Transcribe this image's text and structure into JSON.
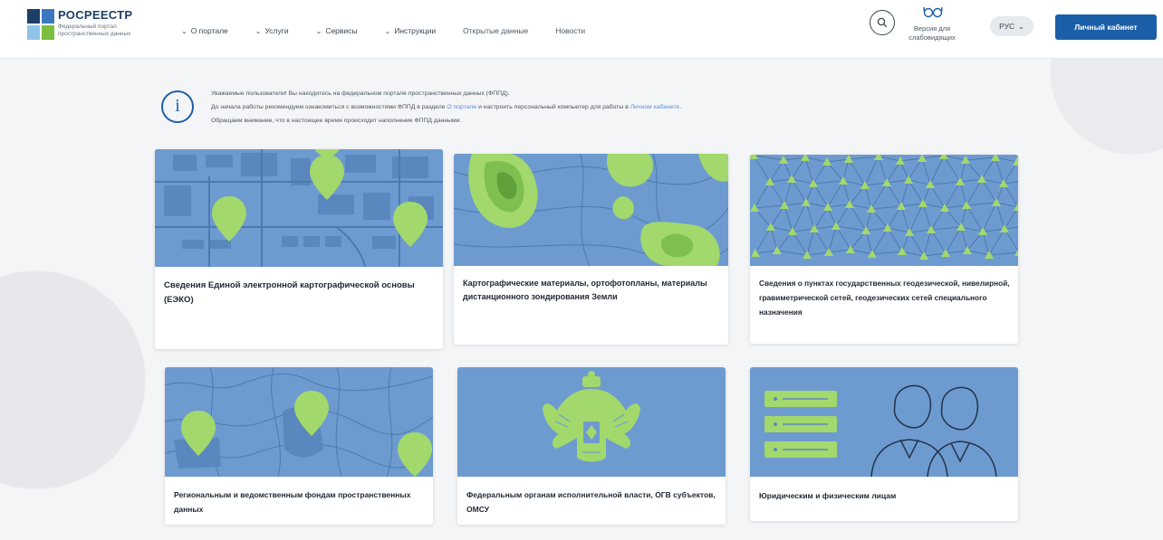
{
  "header": {
    "logo_title": "РОСРЕЕСТР",
    "logo_subtitle": "Федеральный портал пространственных данных",
    "nav": [
      {
        "label": "О портале",
        "has_dropdown": true
      },
      {
        "label": "Услуги",
        "has_dropdown": true
      },
      {
        "label": "Сервисы",
        "has_dropdown": true
      },
      {
        "label": "Инструкции",
        "has_dropdown": true
      },
      {
        "label": "Открытые данные",
        "has_dropdown": false
      },
      {
        "label": "Новости",
        "has_dropdown": false
      }
    ],
    "search_icon": "search-icon",
    "accessibility_label": "Версия для слабовидящих",
    "accessibility_icon": "glasses-icon",
    "language": "РУС",
    "cabinet_button": "Личный кабинет"
  },
  "notice": {
    "icon": "info-icon",
    "line1": "Уважаемые пользователи! Вы находитесь на федеральном портале пространственных данных (ФППД).",
    "line2_before": "До начала работы рекомендуем ознакомиться с возможностями ФППД в разделе ",
    "line2_link1": "О портале",
    "line2_middle": " и настроить персональный компьютер для работы в ",
    "line2_link2": "Личном кабинете",
    "line2_after": ".",
    "line3": "Обращаем внимание, что в настоящее время происходит наполнение ФППД данными."
  },
  "cards": [
    {
      "title": "Сведения Единой электронной картографической основы (ЕЭКО)",
      "image": "city-map-with-pins"
    },
    {
      "title": "Картографические материалы, ортофотопланы, материалы дистанционного зондирования Земли",
      "image": "topographic-contours"
    },
    {
      "title": "Сведения о пунктах государственных геодезической, нивелирной, гравиметрической сетей, геодезических сетей специального назначения",
      "image": "triangulation-network"
    },
    {
      "title": "Региональным и ведомственным фондам пространственных данных",
      "image": "regions-map-with-pins"
    },
    {
      "title": "Федеральным органам исполнительной власти, ОГВ субъектов, ОМСУ",
      "image": "coat-of-arms"
    },
    {
      "title": "Юридическим и физическим лицам",
      "image": "people-and-documents"
    }
  ],
  "colors": {
    "card_image_bg": "#6d9bd0",
    "accent_green": "#a3d86c",
    "primary_blue": "#1b5fa8"
  }
}
